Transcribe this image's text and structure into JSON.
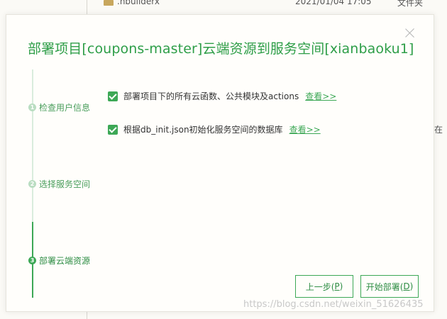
{
  "background": {
    "file_name": ".hbuilderx",
    "file_date": "2021/01/04 17:05",
    "file_type": "文件夹",
    "right_edge_text": "在"
  },
  "dialog": {
    "title": "部署项目[coupons-master]云端资源到服务空间[xianbaoku1]",
    "steps": [
      {
        "number": "1",
        "label": "检查用户信息",
        "active": false
      },
      {
        "number": "2",
        "label": "选择服务空间",
        "active": false
      },
      {
        "number": "3",
        "label": "部署云端资源",
        "active": true
      }
    ],
    "options": [
      {
        "label": "部署项目下的所有云函数、公共模块及actions",
        "checked": true,
        "link": "查看>>"
      },
      {
        "label": "根据db_init.json初始化服务空间的数据库",
        "checked": true,
        "link": "查看>>"
      }
    ],
    "buttons": {
      "prev_label": "上一步(",
      "prev_key": "P",
      "prev_suffix": ")",
      "start_label": "开始部署(",
      "start_key": "D",
      "start_suffix": ")"
    }
  },
  "watermark": "https://blog.csdn.net/weixin_51626435",
  "colors": {
    "accent": "#3da856",
    "title": "#2e9e48"
  }
}
